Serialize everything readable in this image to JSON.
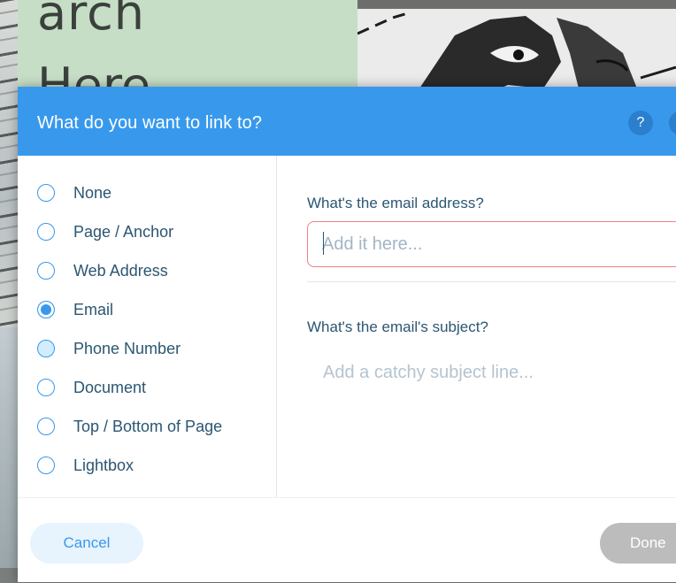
{
  "background": {
    "heading_line1": "arch",
    "heading_line2": "Here"
  },
  "dialog": {
    "title": "What do you want to link to?",
    "help_label": "?",
    "options": [
      {
        "label": "None",
        "state": "unchecked"
      },
      {
        "label": "Page / Anchor",
        "state": "unchecked"
      },
      {
        "label": "Web Address",
        "state": "unchecked"
      },
      {
        "label": "Email",
        "state": "checked"
      },
      {
        "label": "Phone Number",
        "state": "hover"
      },
      {
        "label": "Document",
        "state": "unchecked"
      },
      {
        "label": "Top / Bottom of Page",
        "state": "unchecked"
      },
      {
        "label": "Lightbox",
        "state": "unchecked"
      }
    ],
    "email": {
      "label": "What's the email address?",
      "placeholder": "Add it here...",
      "value": ""
    },
    "subject": {
      "label": "What's the email's subject?",
      "placeholder": "Add a catchy subject line...",
      "value": ""
    },
    "footer": {
      "cancel_label": "Cancel",
      "done_label": "Done"
    }
  },
  "colors": {
    "header": "#3899ec",
    "text": "#2b5672",
    "error_border": "#f0817f",
    "disabled_button": "#bcbcbc"
  }
}
